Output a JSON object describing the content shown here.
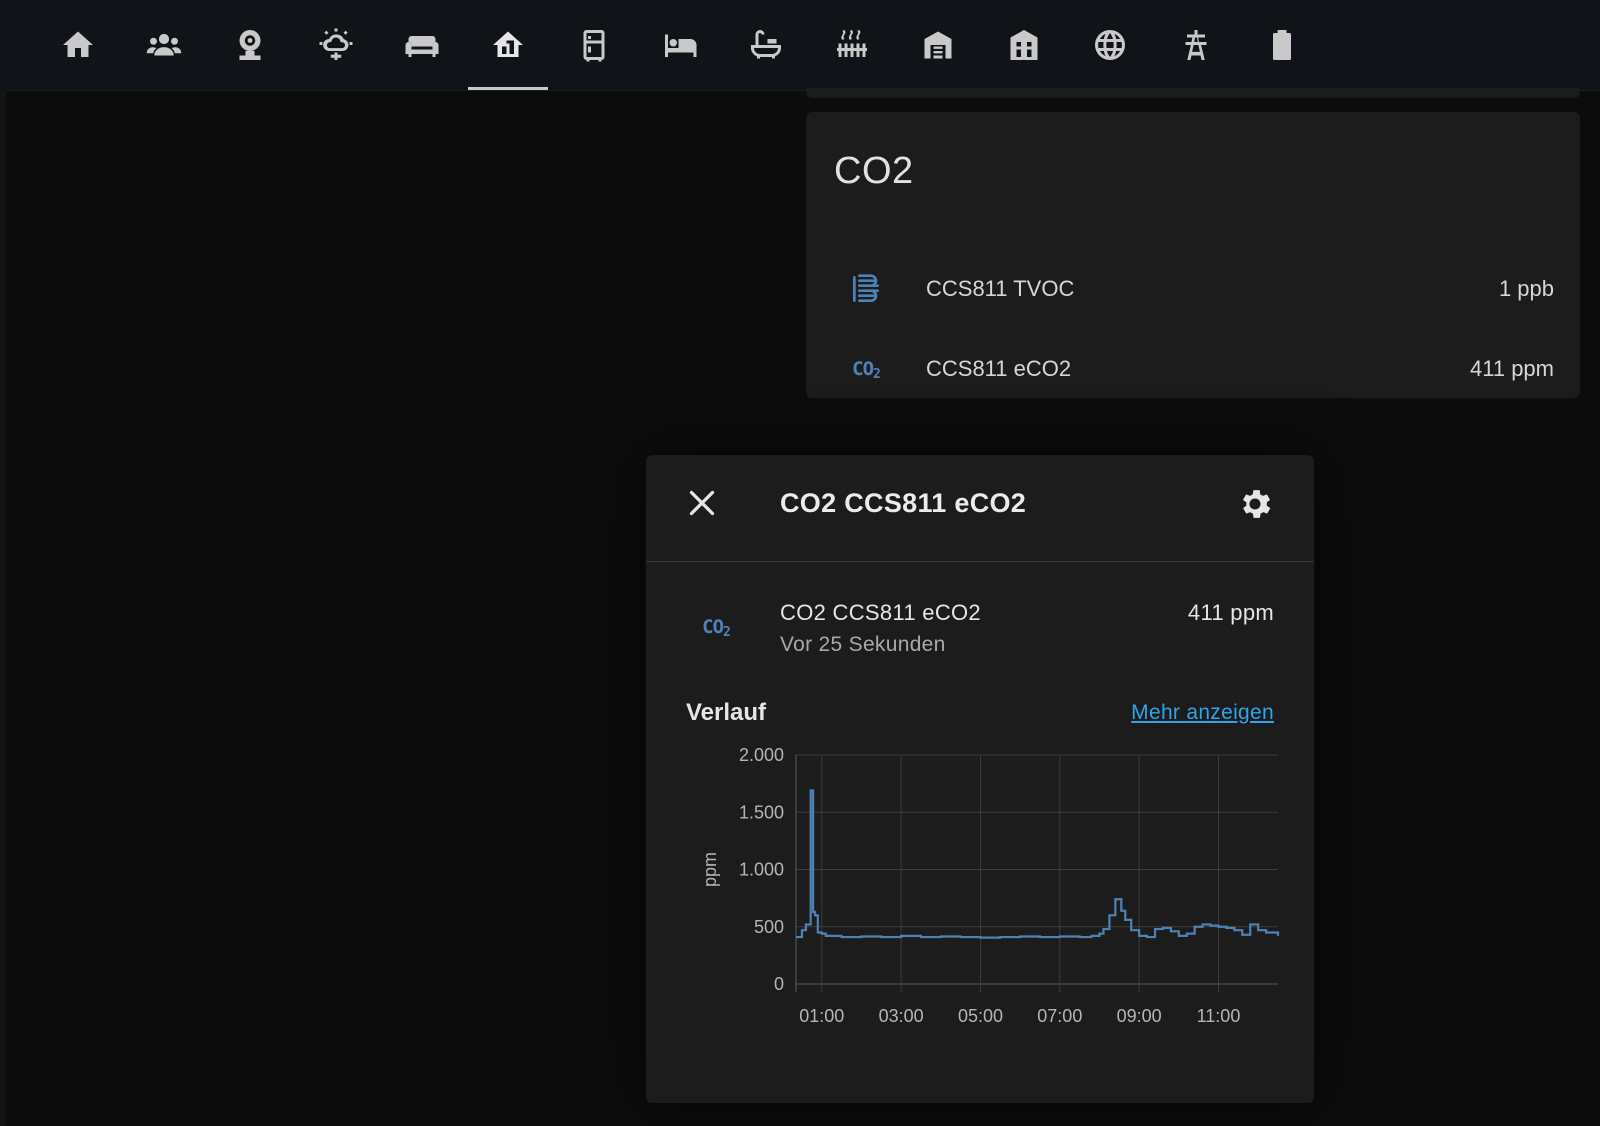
{
  "toolbar": {
    "tabs": [
      {
        "icon": "home-icon"
      },
      {
        "icon": "account-group-icon"
      },
      {
        "icon": "webcam-icon"
      },
      {
        "icon": "weather-icon"
      },
      {
        "icon": "sofa-icon"
      },
      {
        "icon": "home-floor-icon",
        "active": true
      },
      {
        "icon": "fridge-icon"
      },
      {
        "icon": "bed-icon"
      },
      {
        "icon": "bathtub-icon"
      },
      {
        "icon": "radiator-icon"
      },
      {
        "icon": "garage-icon"
      },
      {
        "icon": "home-modern-icon"
      },
      {
        "icon": "globe-icon"
      },
      {
        "icon": "transmission-tower-icon"
      },
      {
        "icon": "battery-icon"
      }
    ]
  },
  "card": {
    "title": "CO2",
    "entities": [
      {
        "icon": "air-filter-icon",
        "name": "CCS811 TVOC",
        "value": "1 ppb"
      },
      {
        "icon": "co2-icon",
        "name": "CCS811 eCO2",
        "value": "411 ppm"
      }
    ]
  },
  "dialog": {
    "title": "CO2 CCS811 eCO2",
    "entity": {
      "icon": "co2-icon",
      "name": "CO2 CCS811 eCO2",
      "value": "411 ppm",
      "last_changed": "Vor 25 Sekunden"
    },
    "history_label": "Verlauf",
    "more_label": "Mehr anzeigen"
  },
  "colors": {
    "accent": "#2fa4ea",
    "series": "#4e82b6",
    "card_bg": "#1c1c1c",
    "page_bg": "#0c0c0c"
  },
  "chart_data": {
    "type": "line",
    "ylabel": "ppm",
    "ylim": [
      0,
      2000
    ],
    "yticks": [
      0,
      500,
      1000,
      1500,
      2000
    ],
    "ytick_labels": [
      "0",
      "500",
      "1.000",
      "1.500",
      "2.000"
    ],
    "xlim_hours": [
      0.35,
      12.5
    ],
    "xticks_hours": [
      1,
      3,
      5,
      7,
      9,
      11
    ],
    "xtick_labels": [
      "01:00",
      "03:00",
      "05:00",
      "07:00",
      "09:00",
      "11:00"
    ],
    "grid": true,
    "step": true,
    "series": [
      {
        "x_hours": [
          0.35,
          0.5,
          0.6,
          0.72,
          0.78,
          0.83,
          0.9,
          1.0,
          1.1,
          1.5,
          2.0,
          2.5,
          3.0,
          3.5,
          4.0,
          4.5,
          5.0,
          5.5,
          6.0,
          6.5,
          7.0,
          7.5,
          7.8,
          8.0,
          8.1,
          8.25,
          8.4,
          8.55,
          8.65,
          8.8,
          9.0,
          9.2,
          9.4,
          9.6,
          9.8,
          10.0,
          10.2,
          10.4,
          10.6,
          10.8,
          11.0,
          11.2,
          11.4,
          11.6,
          11.8,
          12.0,
          12.2,
          12.5
        ],
        "values": [
          410,
          470,
          520,
          1690,
          630,
          600,
          450,
          440,
          420,
          410,
          415,
          410,
          420,
          410,
          415,
          410,
          405,
          410,
          415,
          410,
          415,
          410,
          420,
          440,
          480,
          600,
          740,
          640,
          560,
          470,
          420,
          410,
          480,
          490,
          460,
          420,
          440,
          500,
          520,
          510,
          500,
          490,
          470,
          430,
          520,
          470,
          450,
          420
        ]
      }
    ]
  }
}
